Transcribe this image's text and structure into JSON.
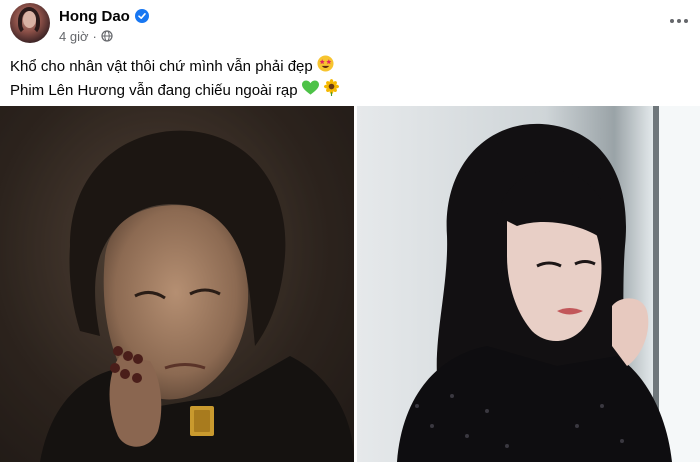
{
  "post": {
    "author": "Hong Dao",
    "time": "4 giờ",
    "separator": "·",
    "caption_line1": "Khổ cho nhân vật thôi chứ mình vẫn phải đẹp",
    "caption_line2": "Phim Lên Hương vẫn đang chiếu ngoài rạp"
  },
  "icons": {
    "verified": "verified-badge-icon",
    "audience": "globe-icon",
    "more": "more-options-icon",
    "emoji1": "star-struck-emoji",
    "emoji2": "green-heart-emoji",
    "emoji3": "sunflower-emoji"
  },
  "colors": {
    "accent": "#1877f2",
    "secondary_text": "#65676b",
    "primary_text": "#050505"
  }
}
